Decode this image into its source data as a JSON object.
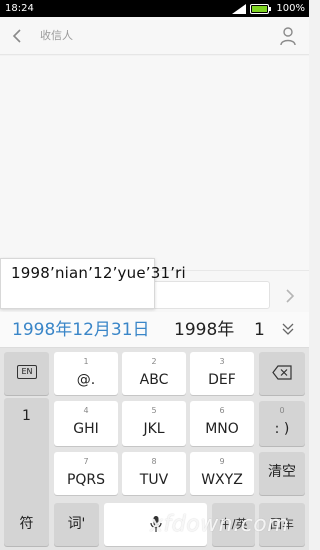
{
  "status_bar": {
    "time": "18:24",
    "battery": "100%"
  },
  "header": {
    "recipient_placeholder": "收信人"
  },
  "pinyin_popup": {
    "text": "1998’nian’12’yue’31’ri"
  },
  "candidates": [
    "1998年12月31日",
    "1998年",
    "1"
  ],
  "keyboard": {
    "en_label": "EN",
    "list_items": [
      "1"
    ],
    "keys": [
      {
        "num": "1",
        "label": "@."
      },
      {
        "num": "2",
        "label": "ABC"
      },
      {
        "num": "3",
        "label": "DEF"
      },
      {
        "num": "4",
        "label": "GHI"
      },
      {
        "num": "5",
        "label": "JKL"
      },
      {
        "num": "6",
        "label": "MNO"
      },
      {
        "num": "7",
        "label": "PQRS"
      },
      {
        "num": "8",
        "label": "TUV"
      },
      {
        "num": "9",
        "label": "WXYZ"
      }
    ],
    "zero_num": "0",
    "zero_label": ": )",
    "clear_label": "清空",
    "sym_label": "符",
    "ci_label": "词'",
    "zh_label": "中/英",
    "enter_label": "回车"
  },
  "watermark": "xfdown.com",
  "colors": {
    "accent": "#3a86c8"
  }
}
